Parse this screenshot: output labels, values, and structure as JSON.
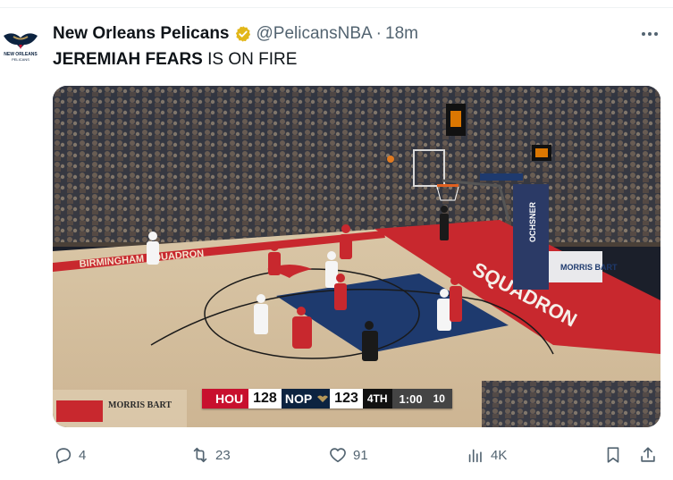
{
  "tweet": {
    "author_name": "New Orleans Pelicans",
    "handle": "@PelicansNBA",
    "separator": "·",
    "time": "18m",
    "text_bold": "JEREMIAH FEARS",
    "text_rest": " IS ON FIRE",
    "avatar_text_line1": "NEW ORLEANS",
    "avatar_text_line2": "PELICANS"
  },
  "scorebug": {
    "home_abbr": "HOU",
    "home_score": "128",
    "away_abbr": "NOP",
    "away_score": "123",
    "period": "4TH",
    "clock": "1:00",
    "shot_clock": "10"
  },
  "court_text": {
    "sponsor_banner": "BIRMINGHAM SQUADRON",
    "baseline_text": "SQUADRON",
    "sponsor_left": "MORRIS BART",
    "sponsor_right": "MORRIS BART",
    "stanchion_text": "OCHSNER"
  },
  "metrics": {
    "replies": "4",
    "reposts": "23",
    "likes": "91",
    "views": "4K"
  },
  "colors": {
    "verified_gold": "#e2b719",
    "muted": "#536471",
    "court_wood": "#d8c4a4",
    "court_red": "#c8282e",
    "paint_navy": "#1e3a6e"
  }
}
